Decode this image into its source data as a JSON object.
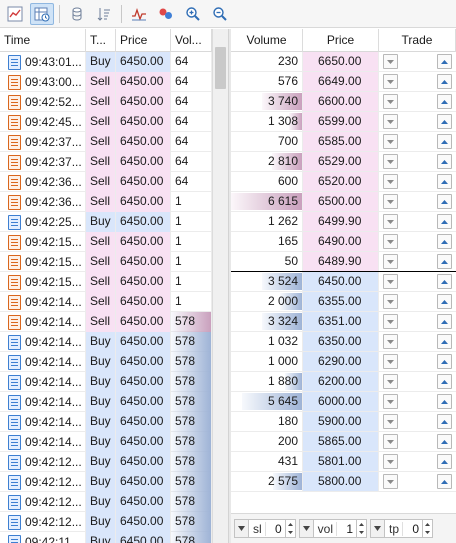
{
  "colors": {
    "buy": "#d9e6fb",
    "sell": "#f8e1f3",
    "ask_bar": "#c9a0bd",
    "bid_bar": "#9eb3d6",
    "accent": "#3d7fd1"
  },
  "toolbar": {
    "icons": [
      "chart-line-icon",
      "clock-table-icon",
      "cylinder-icon",
      "sort-icon",
      "signal-icon",
      "bubbles-icon",
      "zoom-in-icon",
      "zoom-out-icon"
    ]
  },
  "trades": {
    "headers": {
      "time": "Time",
      "type": "T...",
      "price": "Price",
      "volume": "Vol..."
    },
    "rows": [
      {
        "time": "09:43:01...",
        "type": "Buy",
        "side": "buy",
        "price": "6450.00",
        "volume": "64"
      },
      {
        "time": "09:43:00...",
        "type": "Sell",
        "side": "sell",
        "price": "6450.00",
        "volume": "64"
      },
      {
        "time": "09:42:52...",
        "type": "Sell",
        "side": "sell",
        "price": "6450.00",
        "volume": "64"
      },
      {
        "time": "09:42:45...",
        "type": "Sell",
        "side": "sell",
        "price": "6450.00",
        "volume": "64"
      },
      {
        "time": "09:42:37...",
        "type": "Sell",
        "side": "sell",
        "price": "6450.00",
        "volume": "64"
      },
      {
        "time": "09:42:37...",
        "type": "Sell",
        "side": "sell",
        "price": "6450.00",
        "volume": "64"
      },
      {
        "time": "09:42:36...",
        "type": "Sell",
        "side": "sell",
        "price": "6450.00",
        "volume": "64"
      },
      {
        "time": "09:42:36...",
        "type": "Sell",
        "side": "sell",
        "price": "6450.00",
        "volume": "1"
      },
      {
        "time": "09:42:25...",
        "type": "Buy",
        "side": "buy",
        "price": "6450.00",
        "volume": "1"
      },
      {
        "time": "09:42:15...",
        "type": "Sell",
        "side": "sell",
        "price": "6450.00",
        "volume": "1"
      },
      {
        "time": "09:42:15...",
        "type": "Sell",
        "side": "sell",
        "price": "6450.00",
        "volume": "1"
      },
      {
        "time": "09:42:15...",
        "type": "Sell",
        "side": "sell",
        "price": "6450.00",
        "volume": "1"
      },
      {
        "time": "09:42:14...",
        "type": "Sell",
        "side": "sell",
        "price": "6450.00",
        "volume": "1"
      },
      {
        "time": "09:42:14...",
        "type": "Sell",
        "side": "sell",
        "price": "6450.00",
        "volume": "578"
      },
      {
        "time": "09:42:14...",
        "type": "Buy",
        "side": "buy",
        "price": "6450.00",
        "volume": "578"
      },
      {
        "time": "09:42:14...",
        "type": "Buy",
        "side": "buy",
        "price": "6450.00",
        "volume": "578"
      },
      {
        "time": "09:42:14...",
        "type": "Buy",
        "side": "buy",
        "price": "6450.00",
        "volume": "578"
      },
      {
        "time": "09:42:14...",
        "type": "Buy",
        "side": "buy",
        "price": "6450.00",
        "volume": "578"
      },
      {
        "time": "09:42:14...",
        "type": "Buy",
        "side": "buy",
        "price": "6450.00",
        "volume": "578"
      },
      {
        "time": "09:42:14...",
        "type": "Buy",
        "side": "buy",
        "price": "6450.00",
        "volume": "578"
      },
      {
        "time": "09:42:12...",
        "type": "Buy",
        "side": "buy",
        "price": "6450.00",
        "volume": "578"
      },
      {
        "time": "09:42:12...",
        "type": "Buy",
        "side": "buy",
        "price": "6450.00",
        "volume": "578"
      },
      {
        "time": "09:42:12...",
        "type": "Buy",
        "side": "buy",
        "price": "6450.00",
        "volume": "578"
      },
      {
        "time": "09:42:12...",
        "type": "Buy",
        "side": "buy",
        "price": "6450.00",
        "volume": "578"
      },
      {
        "time": "09:42:11...",
        "type": "Buy",
        "side": "buy",
        "price": "6450.00",
        "volume": "578"
      }
    ]
  },
  "depth": {
    "headers": {
      "volume": "Volume",
      "price": "Price",
      "trade": "Trade"
    },
    "rows": [
      {
        "volume": "230",
        "price": "6650.00",
        "side": "ask",
        "level": 0.0
      },
      {
        "volume": "576",
        "price": "6649.00",
        "side": "ask",
        "level": 0.0
      },
      {
        "volume": "3 740",
        "price": "6600.00",
        "side": "ask",
        "level": 0.55
      },
      {
        "volume": "1 308",
        "price": "6599.00",
        "side": "ask",
        "level": 0.18
      },
      {
        "volume": "700",
        "price": "6585.00",
        "side": "ask",
        "level": 0.0
      },
      {
        "volume": "2 810",
        "price": "6529.00",
        "side": "ask",
        "level": 0.42
      },
      {
        "volume": "600",
        "price": "6520.00",
        "side": "ask",
        "level": 0.0
      },
      {
        "volume": "6 615",
        "price": "6500.00",
        "side": "ask",
        "level": 1.0
      },
      {
        "volume": "1 262",
        "price": "6499.90",
        "side": "ask",
        "level": 0.0
      },
      {
        "volume": "165",
        "price": "6490.00",
        "side": "ask",
        "level": 0.0
      },
      {
        "volume": "50",
        "price": "6489.90",
        "side": "ask",
        "level": 0.0
      },
      {
        "volume": "3 524",
        "price": "6450.00",
        "side": "bid",
        "level": 0.56
      },
      {
        "volume": "2 000",
        "price": "6355.00",
        "side": "bid",
        "level": 0.3
      },
      {
        "volume": "3 324",
        "price": "6351.00",
        "side": "bid",
        "level": 0.55
      },
      {
        "volume": "1 032",
        "price": "6350.00",
        "side": "bid",
        "level": 0.0
      },
      {
        "volume": "1 000",
        "price": "6290.00",
        "side": "bid",
        "level": 0.0
      },
      {
        "volume": "1 880",
        "price": "6200.00",
        "side": "bid",
        "level": 0.24
      },
      {
        "volume": "5 645",
        "price": "6000.00",
        "side": "bid",
        "level": 0.84
      },
      {
        "volume": "180",
        "price": "5900.00",
        "side": "bid",
        "level": 0.0
      },
      {
        "volume": "200",
        "price": "5865.00",
        "side": "bid",
        "level": 0.0
      },
      {
        "volume": "431",
        "price": "5801.00",
        "side": "bid",
        "level": 0.0
      },
      {
        "volume": "2 575",
        "price": "5800.00",
        "side": "bid",
        "level": 0.4
      }
    ]
  },
  "controls": {
    "sl": {
      "label": "sl",
      "value": "0"
    },
    "vol": {
      "label": "vol",
      "value": "1"
    },
    "tp": {
      "label": "tp",
      "value": "0"
    }
  }
}
